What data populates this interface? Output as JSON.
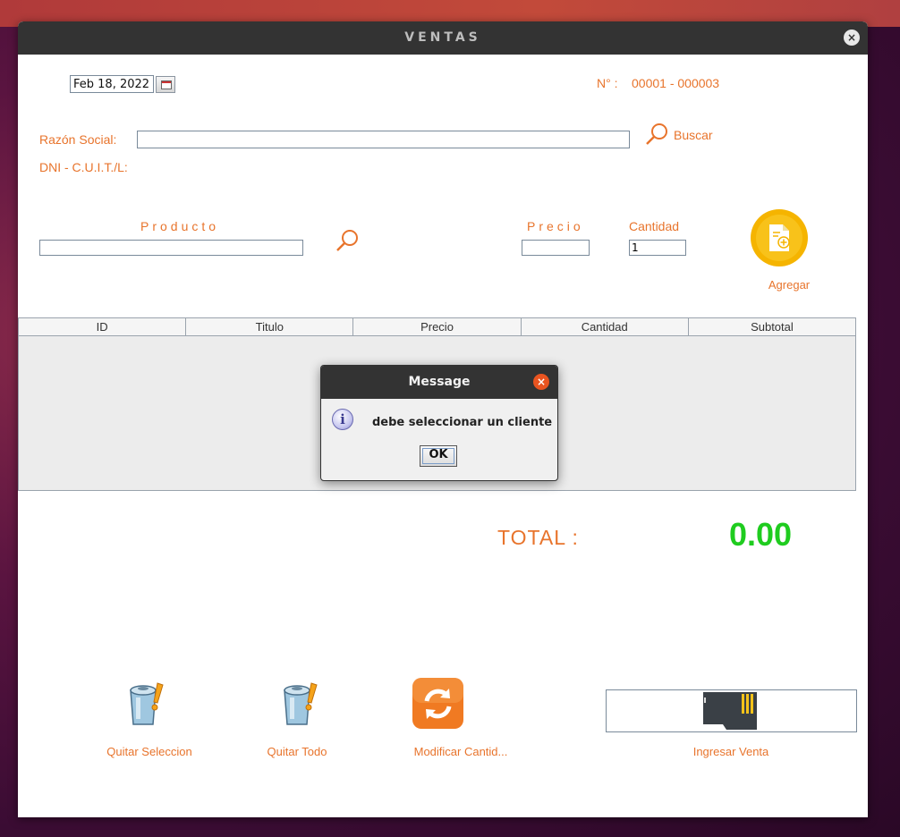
{
  "window": {
    "title": "VENTAS",
    "close_glyph": "×"
  },
  "header": {
    "date": "Feb 18, 2022",
    "invoice_label": "N° :",
    "invoice_number": "00001 - 000003"
  },
  "client": {
    "razon_label": "Razón Social:",
    "razon_value": "",
    "buscar_label": "Buscar",
    "dni_label": "DNI - C.U.I.T./L:"
  },
  "product": {
    "producto_label": "Producto",
    "producto_value": "",
    "precio_label": "Precio",
    "precio_value": "",
    "cantidad_label": "Cantidad",
    "cantidad_value": "1",
    "agregar_label": "Agregar"
  },
  "table": {
    "columns": [
      "ID",
      "Titulo",
      "Precio",
      "Cantidad",
      "Subtotal"
    ]
  },
  "dialog": {
    "title": "Message",
    "message": "debe seleccionar un cliente",
    "ok_label": "OK"
  },
  "totals": {
    "label": "TOTAL :",
    "value": "0.00"
  },
  "actions": {
    "quitar_seleccion": "Quitar Seleccion",
    "quitar_todo": "Quitar Todo",
    "modificar_cantidad": "Modificar Cantid...",
    "ingresar_venta": "Ingresar Venta"
  },
  "colors": {
    "accent": "#e8742c",
    "total": "#1fcc1f",
    "titlebar": "#333333",
    "dialog_close": "#e95420"
  }
}
